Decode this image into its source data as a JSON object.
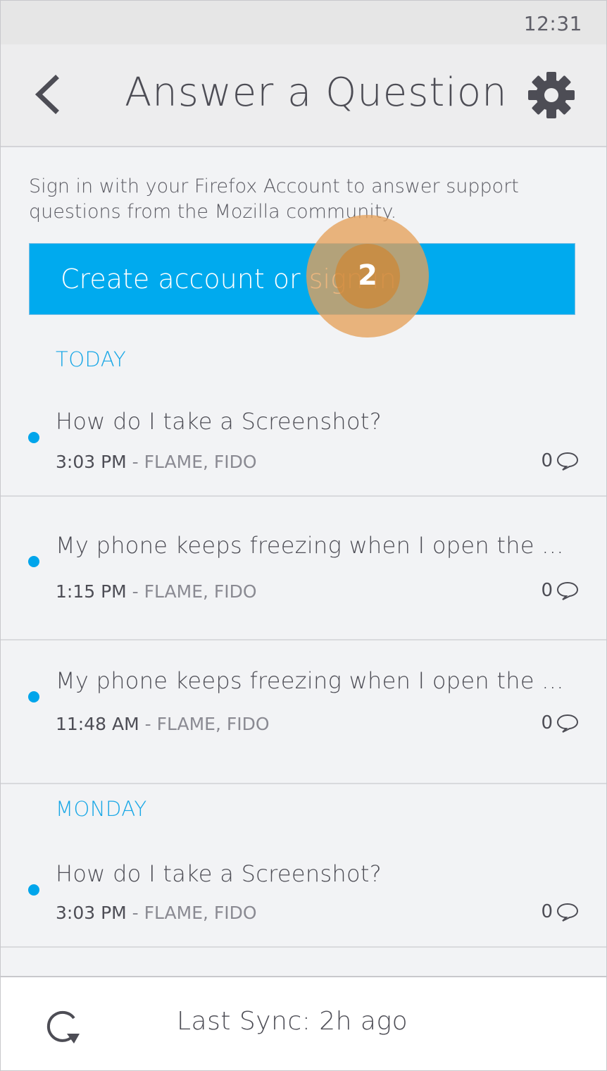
{
  "status_bar": {
    "time": "12:31"
  },
  "header": {
    "title": "Answer a Question",
    "back_icon": "chevron-left-icon",
    "settings_icon": "gear-icon"
  },
  "intro": {
    "text": "Sign in with your Firefox Account to answer support questions from the Mozilla community."
  },
  "signin": {
    "label": "Create account or sign in"
  },
  "annotation": {
    "number": "2"
  },
  "sections": [
    {
      "label": "TODAY",
      "questions": [
        {
          "title": "How do I take a Screenshot?",
          "time": "3:03 PM",
          "tags": "FLAME, FIDO",
          "count": "0"
        },
        {
          "title": "My phone keeps freezing when I open the ...",
          "time": "1:15 PM",
          "tags": "FLAME, FIDO",
          "count": "0"
        },
        {
          "title": "My phone keeps freezing when I open the ...",
          "time": "11:48 AM",
          "tags": "FLAME, FIDO",
          "count": "0"
        }
      ]
    },
    {
      "label": "MONDAY",
      "questions": [
        {
          "title": "How do I take a Screenshot?",
          "time": "3:03 PM",
          "tags": "FLAME, FIDO",
          "count": "0"
        }
      ]
    }
  ],
  "meta_separator": " - ",
  "footer": {
    "sync_text": "Last Sync: 2h ago",
    "sync_icon": "refresh-icon"
  },
  "colors": {
    "accent": "#00aaee",
    "section_label": "#18a7e6",
    "unread_dot": "#00a5eb",
    "marker": "#e6a05a"
  }
}
